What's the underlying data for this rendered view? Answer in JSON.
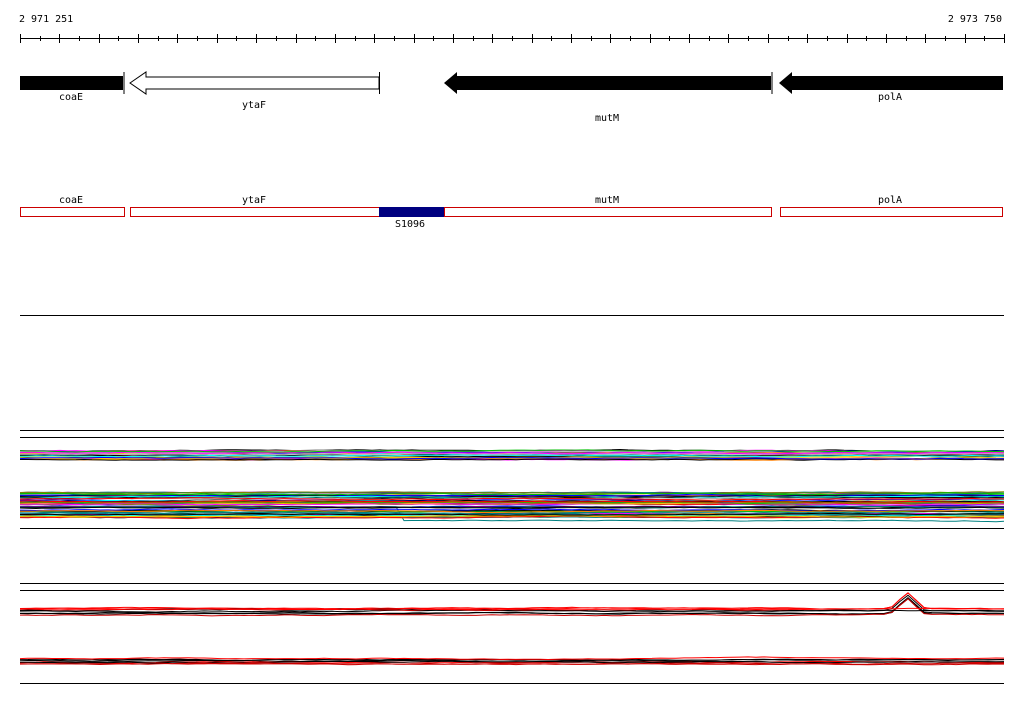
{
  "ruler": {
    "start_label": "2 971 251",
    "end_label": "2 973 750"
  },
  "genes": [
    {
      "name": "coaE",
      "strand": "-",
      "style": "filled",
      "color": "#000000"
    },
    {
      "name": "ytaF",
      "strand": "-",
      "style": "outline",
      "color": "#000000"
    },
    {
      "name": "mutM",
      "strand": "-",
      "style": "filled",
      "color": "#000000"
    },
    {
      "name": "polA",
      "strand": "-",
      "style": "filled",
      "color": "#000000"
    }
  ],
  "transcripts": [
    {
      "name": "coaE",
      "color": "#cc0000"
    },
    {
      "name": "ytaF",
      "color": "#cc0000"
    },
    {
      "name": "mutM",
      "color": "#cc0000"
    },
    {
      "name": "polA",
      "color": "#cc0000"
    }
  ],
  "feature": {
    "name": "S1096",
    "color": "#000080"
  },
  "colors": {
    "background": "#ffffff",
    "gene_fill": "#000000",
    "transcript_outline": "#cc0000",
    "feature_fill": "#000080",
    "track_palette": [
      "#000000",
      "#ff0000",
      "#00c000",
      "#0000ff",
      "#ff00ff",
      "#00ffff",
      "#ffcc00",
      "#808000",
      "#800080",
      "#008080",
      "#ff8000",
      "#c0c0c0"
    ]
  }
}
